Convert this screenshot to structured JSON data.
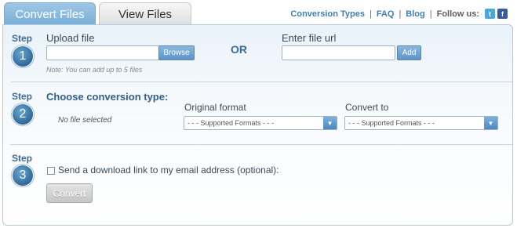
{
  "tabs": [
    {
      "label": "Convert Files",
      "active": true
    },
    {
      "label": "View Files",
      "active": false
    }
  ],
  "top_links": {
    "conversion_types": "Conversion Types",
    "faq": "FAQ",
    "blog": "Blog",
    "separator": "|",
    "follow_us": "Follow us:",
    "twitter_icon": "t",
    "facebook_icon": "f"
  },
  "step1": {
    "step_label": "Step",
    "number": "1",
    "upload_label": "Upload file",
    "browse_button": "Browse",
    "note": "Note: You can add up to 5 files",
    "or_label": "OR",
    "url_label": "Enter file url",
    "add_button": "Add"
  },
  "step2": {
    "step_label": "Step",
    "number": "2",
    "heading": "Choose conversion type:",
    "no_file": "No file selected",
    "original_format_label": "Original format",
    "original_format_value": "- - - Supported Formats - - -",
    "convert_to_label": "Convert to",
    "convert_to_value": "- - - Supported Formats - - -"
  },
  "step3": {
    "step_label": "Step",
    "number": "3",
    "email_checkbox_label": "Send a download link to my email address (optional):",
    "convert_button": "Convert"
  },
  "colors": {
    "accent": "#3f7fb8",
    "step_blue": "#2f6a9b",
    "tab_active": "#78afd9"
  }
}
